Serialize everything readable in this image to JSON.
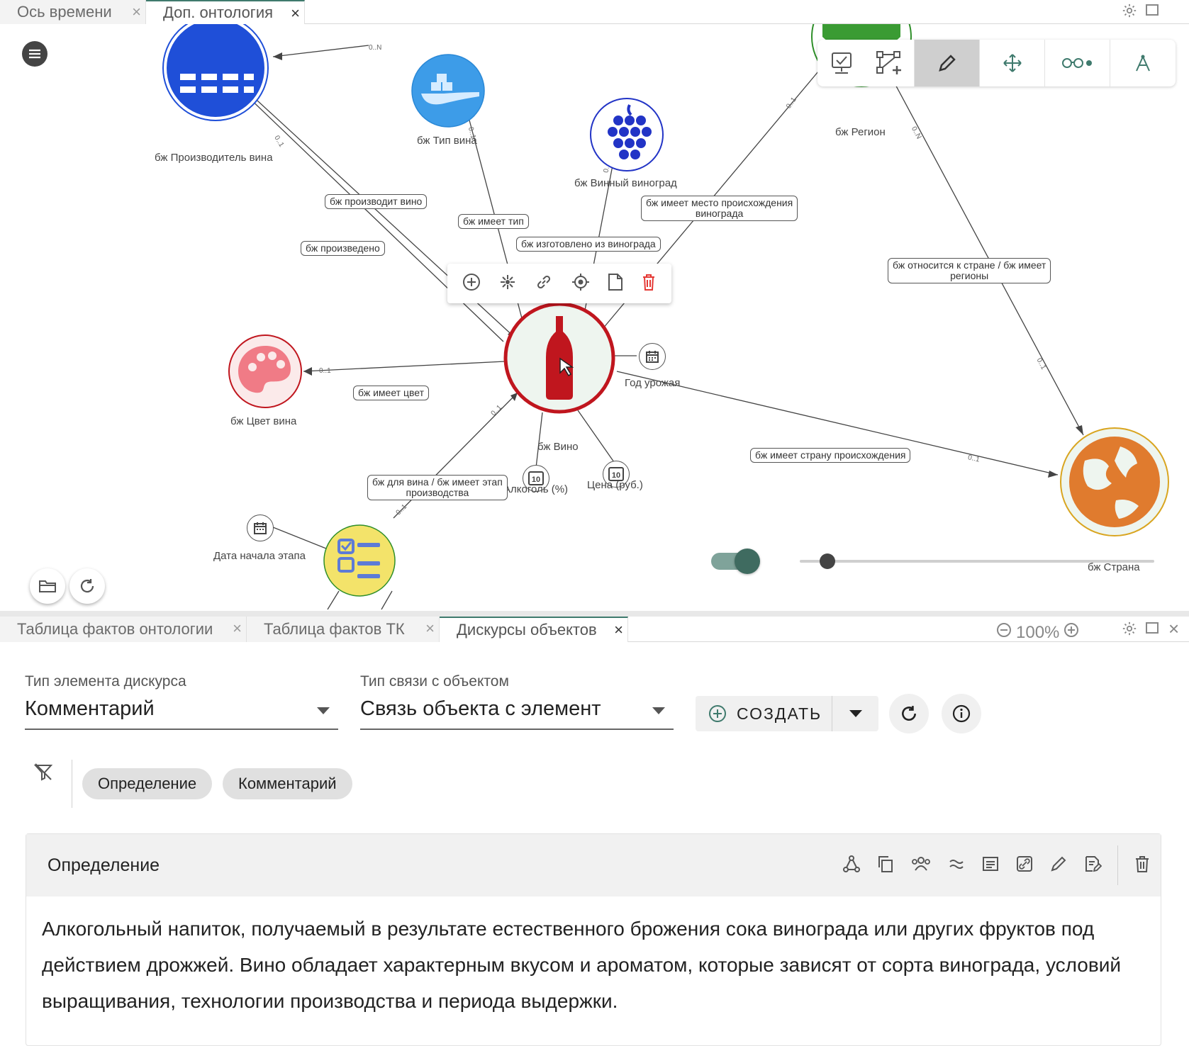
{
  "top_tabs": [
    {
      "label": "Ось времени",
      "active": false
    },
    {
      "label": "Доп. онтология",
      "active": true
    }
  ],
  "graph": {
    "nodes": {
      "manufacturer": "бж Производитель вина",
      "wine_type": "бж Тип вина",
      "grape": "бж Винный виноград",
      "region": "бж Регион",
      "color": "бж Цвет вина",
      "wine": "бж Вино",
      "country": "бж Страна"
    },
    "attributes": {
      "harvest_year": "Год урожая",
      "alcohol": "Алкоголь (%)",
      "price": "Цена (руб.)",
      "stage_start": "Дата начала этапа"
    },
    "edges": {
      "produces_wine": "бж производит вино",
      "produced": "бж произведено",
      "has_type": "бж имеет тип",
      "made_from_grape": "бж изготовлено из винограда",
      "grape_origin_l1": "бж имеет место происхождения",
      "grape_origin_l2": "винограда",
      "country_region_l1": "бж относится к стране / бж имеет",
      "country_region_l2": "регионы",
      "has_color": "бж имеет цвет",
      "has_country": "бж имеет страну происхождения",
      "stage_l1": "бж для вина / бж имеет этап",
      "stage_l2": "производства"
    },
    "multiplicities": {
      "m01": "0..1",
      "m0n": "0..N"
    }
  },
  "bottom_tabs": [
    {
      "label": "Таблица фактов онтологии",
      "active": false
    },
    {
      "label": "Таблица фактов ТК",
      "active": false
    },
    {
      "label": "Дискурсы объектов",
      "active": true
    }
  ],
  "zoom": "100%",
  "form": {
    "element_type_label": "Тип элемента дискурса",
    "element_type_value": "Комментарий",
    "link_type_label": "Тип связи с объектом",
    "link_type_value": "Связь объекта с элемент",
    "create_label": "СОЗДАТЬ"
  },
  "chips": [
    "Определение",
    "Комментарий"
  ],
  "card": {
    "title": "Определение",
    "text": "Алкогольный напиток, получаемый в результате естественного брожения сока винограда или других фруктов под действием дрожжей. Вино обладает характерным вкусом и ароматом, которые зависят от сорта винограда, условий выращивания, технологии производства и периода выдержки."
  },
  "colors": {
    "accent": "#3f7a6d",
    "wine_node_ring": "#c0161e",
    "manufacturer_fill": "#1f4fd8",
    "wine_type_fill": "#3d9ce8",
    "grape_fill": "#2234c6",
    "color_node_fill": "#f07b86",
    "country_fill": "#e07b2e",
    "stage_fill": "#f3e36a",
    "delete_red": "#e53935"
  }
}
